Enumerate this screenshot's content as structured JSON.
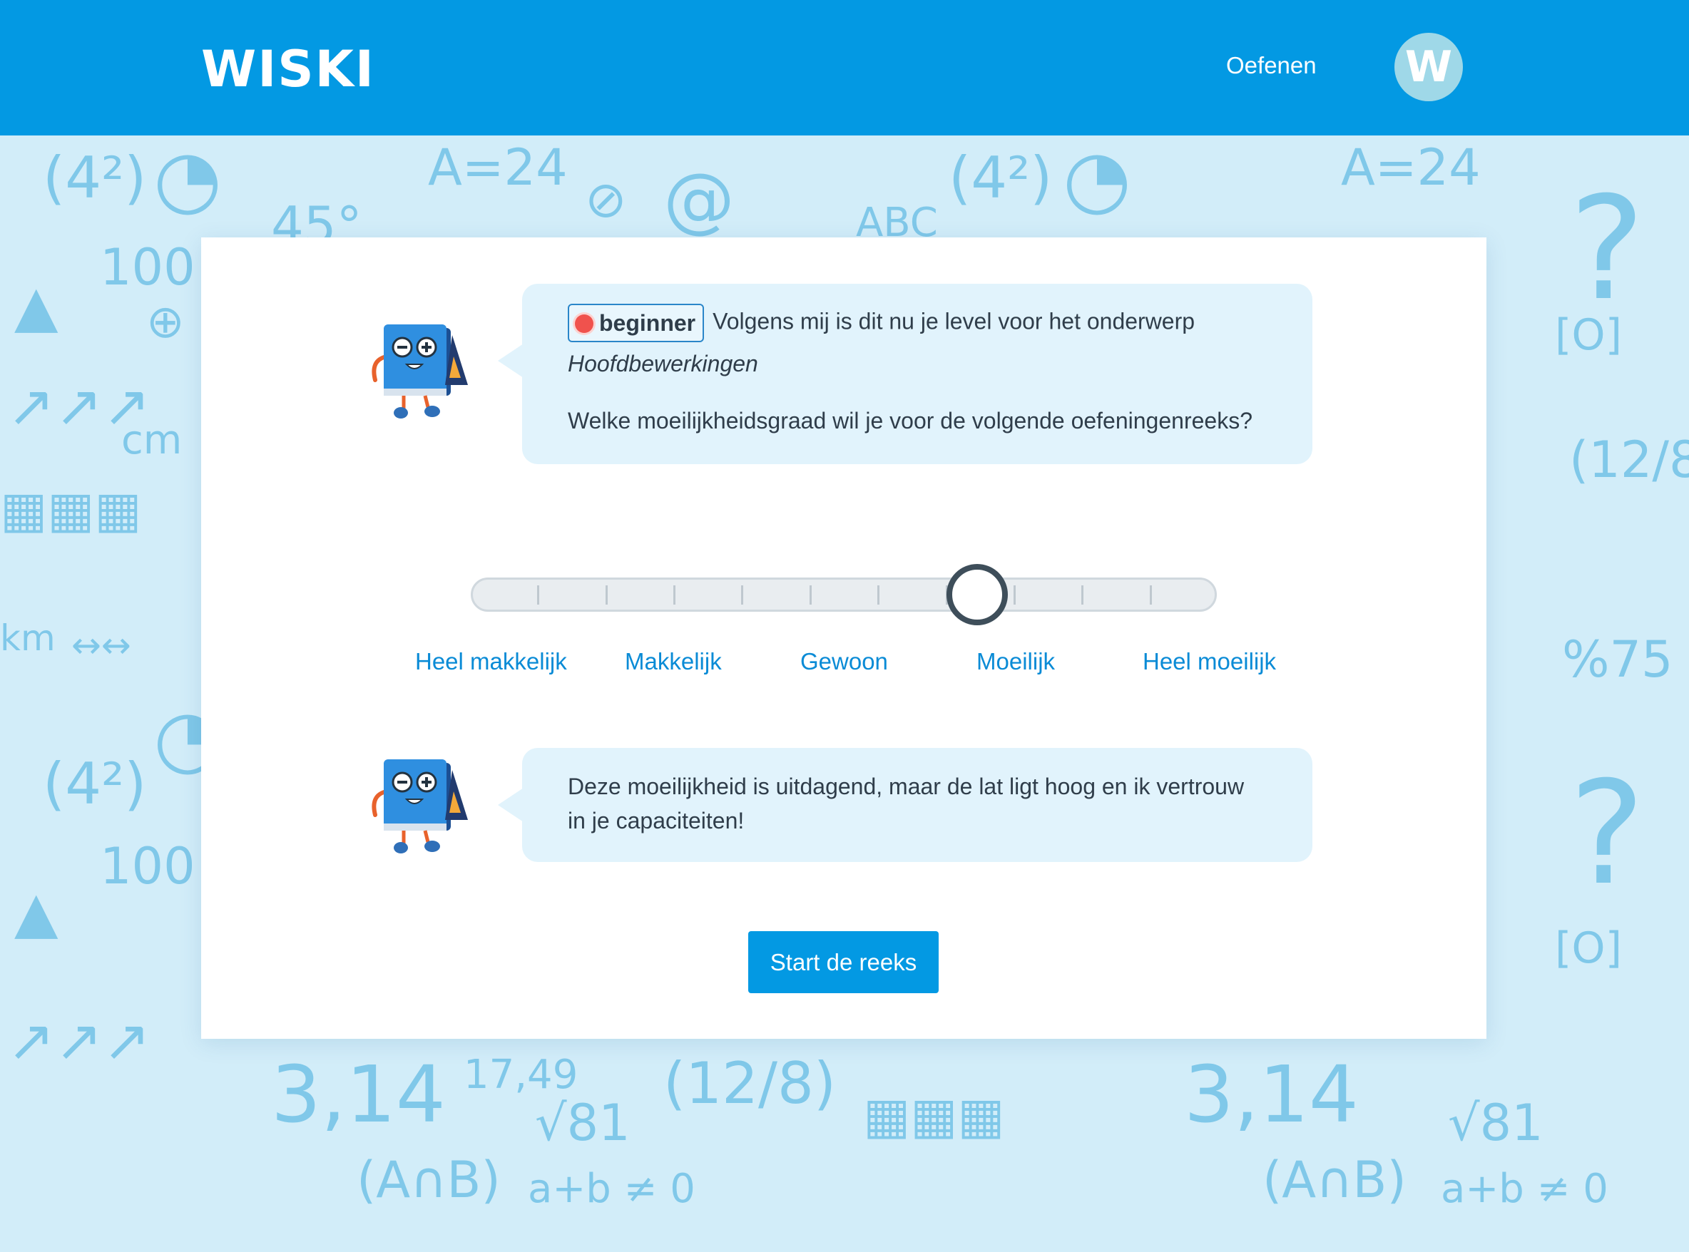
{
  "header": {
    "logo_text": "WISKI",
    "nav_link": "Oefenen",
    "avatar_letter": "W",
    "brand_color": "#0399e3"
  },
  "intro": {
    "level_badge": "beginner",
    "level_icon": "lightbulb-icon",
    "message": "Volgens mij is dit nu je level voor het onderwerp",
    "topic": "Hoofdbewerkingen",
    "question": "Welke moeilijkheidsgraad wil je voor de volgende oefeningenreeks?"
  },
  "difficulty": {
    "options": [
      "Heel makkelijk",
      "Makkelijk",
      "Gewoon",
      "Moeilijk",
      "Heel moeilijk"
    ],
    "selected": "Moeilijk",
    "selected_position": 0.7
  },
  "feedback": {
    "message": "Deze moeilijkheid is uitdagend, maar de lat ligt hoog en ik vertrouw in je capaciteiten!"
  },
  "actions": {
    "start_label": "Start de reeks"
  }
}
